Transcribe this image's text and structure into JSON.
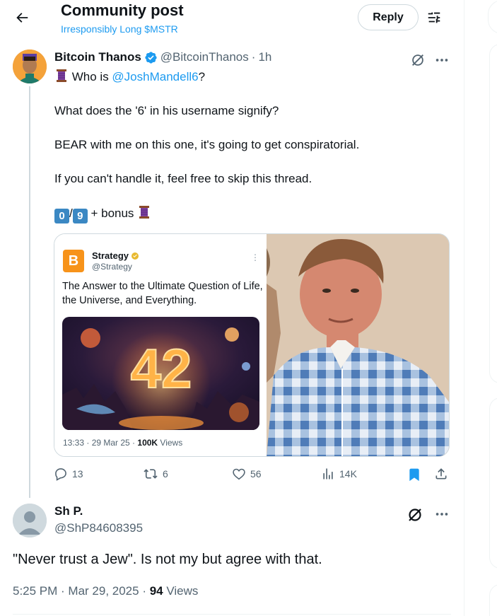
{
  "header": {
    "title": "Community post",
    "community": "Irresponsibly Long $MSTR",
    "reply_button": "Reply"
  },
  "post": {
    "display_name": "Bitcoin Thanos",
    "handle": "@BitcoinThanos",
    "separator": "·",
    "time": "1h",
    "line1_prefix": "Who is ",
    "line1_mention": "@JoshMandell6",
    "line1_suffix": "?",
    "line2": "What does the '6' in his username signify?",
    "line3": "BEAR with me on this one, it's going to get conspiratorial.",
    "line4": "If you can't handle it, feel free to skip this thread.",
    "counter_a": "0",
    "counter_sep": "/",
    "counter_b": "9",
    "counter_suffix": " + bonus",
    "embedded": {
      "name": "Strategy",
      "handle": "@Strategy",
      "text": "The Answer to the Ultimate Question of Life, the Universe, and Everything.",
      "image_number": "42",
      "meta_time": "13:33 · 29 Mar 25 · ",
      "meta_views_num": "100K",
      "meta_views_label": " Views"
    },
    "actions": {
      "replies": "13",
      "reposts": "6",
      "likes": "56",
      "views": "14K"
    }
  },
  "reply": {
    "display_name": "Sh P.",
    "handle": "@ShP84608395",
    "text": "\"Never trust a Jew\". Is not my but agree with that.",
    "meta_time": "5:25 PM · Mar 29, 2025 · ",
    "meta_views_num": "94",
    "meta_views_label": " Views"
  },
  "colors": {
    "accent": "#1d9bf0",
    "secondary_text": "#536471",
    "bitcoin_orange": "#f7931a"
  },
  "icons": [
    "back-arrow-icon",
    "tune-icon",
    "verified-badge-icon",
    "grok-icon",
    "more-icon",
    "thread-spool-icon",
    "reply-icon",
    "repost-icon",
    "like-icon",
    "views-icon",
    "bookmark-icon",
    "share-icon"
  ]
}
